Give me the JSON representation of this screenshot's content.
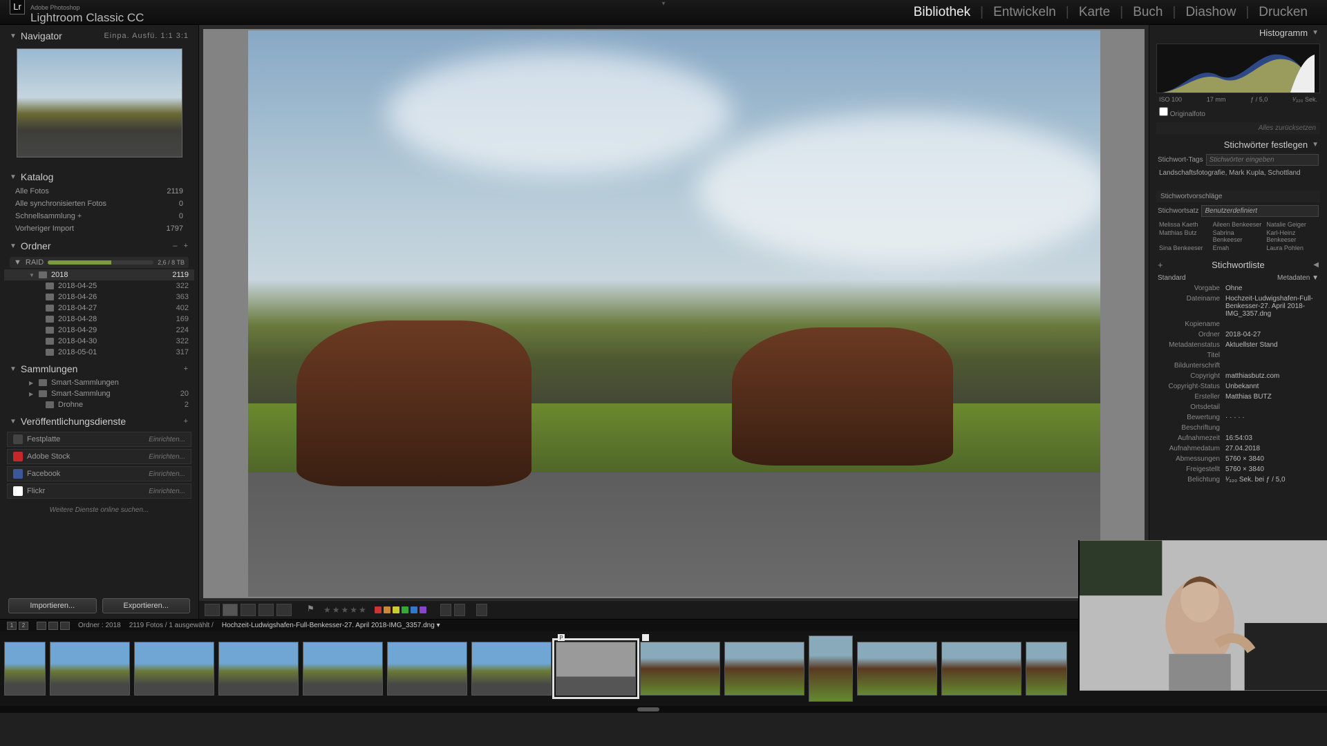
{
  "brand": {
    "icon": "Lr",
    "text": "Adobe Photoshop",
    "product": "Lightroom Classic CC"
  },
  "modules": [
    "Bibliothek",
    "Entwickeln",
    "Karte",
    "Buch",
    "Diashow",
    "Drucken"
  ],
  "active_module": "Bibliothek",
  "navigator": {
    "title": "Navigator",
    "zoom_opts": "Einpa.   Ausfü.   1:1   3:1"
  },
  "katalog": {
    "title": "Katalog",
    "items": [
      {
        "label": "Alle Fotos",
        "count": "2119"
      },
      {
        "label": "Alle synchronisierten Fotos",
        "count": "0"
      },
      {
        "label": "Schnellsammlung  +",
        "count": "0"
      },
      {
        "label": "Vorheriger Import",
        "count": "1797"
      }
    ]
  },
  "ordner": {
    "title": "Ordner",
    "volume": {
      "name": "RAID",
      "status": "2,6 / 8 TB"
    },
    "year": {
      "name": "2018",
      "count": "2119"
    },
    "folders": [
      {
        "name": "2018-04-25",
        "count": "322"
      },
      {
        "name": "2018-04-26",
        "count": "363"
      },
      {
        "name": "2018-04-27",
        "count": "402"
      },
      {
        "name": "2018-04-28",
        "count": "169"
      },
      {
        "name": "2018-04-29",
        "count": "224"
      },
      {
        "name": "2018-04-30",
        "count": "322"
      },
      {
        "name": "2018-05-01",
        "count": "317"
      }
    ]
  },
  "sammlungen": {
    "title": "Sammlungen",
    "items": [
      {
        "label": "Smart-Sammlungen",
        "count": ""
      },
      {
        "label": "Smart-Sammlung",
        "count": "20"
      },
      {
        "label": "Drohne",
        "count": "2"
      }
    ]
  },
  "publish": {
    "title": "Veröffentlichungsdienste",
    "services": [
      {
        "name": "Festplatte",
        "color": "#444",
        "setup": "Einrichten..."
      },
      {
        "name": "Adobe Stock",
        "color": "#c62828",
        "setup": "Einrichten..."
      },
      {
        "name": "Facebook",
        "color": "#3b5998",
        "setup": "Einrichten..."
      },
      {
        "name": "Flickr",
        "color": "#ffffff",
        "setup": "Einrichten..."
      }
    ],
    "find_more": "Weitere Dienste online suchen..."
  },
  "import_btn": "Importieren...",
  "export_btn": "Exportieren...",
  "histogram": {
    "title": "Histogramm",
    "iso": "ISO 100",
    "focal": "17 mm",
    "aperture": "ƒ / 5,0",
    "shutter": "¹⁄₃₂₀ Sek."
  },
  "original_photo_label": "Originalfoto",
  "reset_all": "Alles zurücksetzen",
  "keywords": {
    "title": "Stichwörter festlegen",
    "tags_label": "Stichwort-Tags",
    "placeholder": "Stichwörter eingeben",
    "list": "Landschaftsfotografie, Mark Kupla, Schottland",
    "suggest_label": "Stichwortvorschläge",
    "set_label": "Stichwortsatz",
    "set_value": "Benutzerdefiniert",
    "names": [
      "Melissa Kaeth",
      "Aileen Benkeeser",
      "Natalie Geiger",
      "Matthias Butz",
      "Sabrina Benkeeser",
      "Karl-Heinz Benkeeser",
      "Sina Benkeeser",
      "Emah",
      "Laura Pohlen"
    ]
  },
  "keywordlist_title": "Stichwortliste",
  "metadata": {
    "title": "Metadaten",
    "left_select": "Standard",
    "preset_label": "Vorgabe",
    "preset_value": "Ohne",
    "rows": [
      {
        "lbl": "Dateiname",
        "val": "Hochzeit-Ludwigshafen-Full-Benkesser-27. April 2018-IMG_3357.dng"
      },
      {
        "lbl": "Kopiename",
        "val": ""
      },
      {
        "lbl": "Ordner",
        "val": "2018-04-27"
      },
      {
        "lbl": "Metadatenstatus",
        "val": "Aktuellster Stand"
      },
      {
        "lbl": "Titel",
        "val": ""
      },
      {
        "lbl": "Bildunterschrift",
        "val": ""
      },
      {
        "lbl": "Copyright",
        "val": "matthiasbutz.com"
      },
      {
        "lbl": "Copyright-Status",
        "val": "Unbekannt"
      },
      {
        "lbl": "Ersteller",
        "val": "Matthias BUTZ"
      },
      {
        "lbl": "Ortsdetail",
        "val": ""
      },
      {
        "lbl": "Bewertung",
        "val": "· · · · ·"
      },
      {
        "lbl": "Beschriftung",
        "val": ""
      },
      {
        "lbl": "Aufnahmezeit",
        "val": "16:54:03"
      },
      {
        "lbl": "Aufnahmedatum",
        "val": "27.04.2018"
      },
      {
        "lbl": "Abmessungen",
        "val": "5760 × 3840"
      },
      {
        "lbl": "Freigestellt",
        "val": "5760 × 3840"
      },
      {
        "lbl": "Belichtung",
        "val": "¹⁄₃₂₀ Sek. bei ƒ / 5,0"
      }
    ]
  },
  "info_strip": {
    "screens": [
      "1",
      "2"
    ],
    "breadcrumb": "Ordner : 2018",
    "counts": "2119 Fotos / 1 ausgewählt /",
    "filename": "Hochzeit-Ludwigshafen-Full-Benkesser-27. April 2018-IMG_3357.dng  ▾"
  },
  "color_labels": [
    "#cc3333",
    "#cc8833",
    "#cccc33",
    "#33aa33",
    "#3377cc",
    "#8844cc"
  ]
}
